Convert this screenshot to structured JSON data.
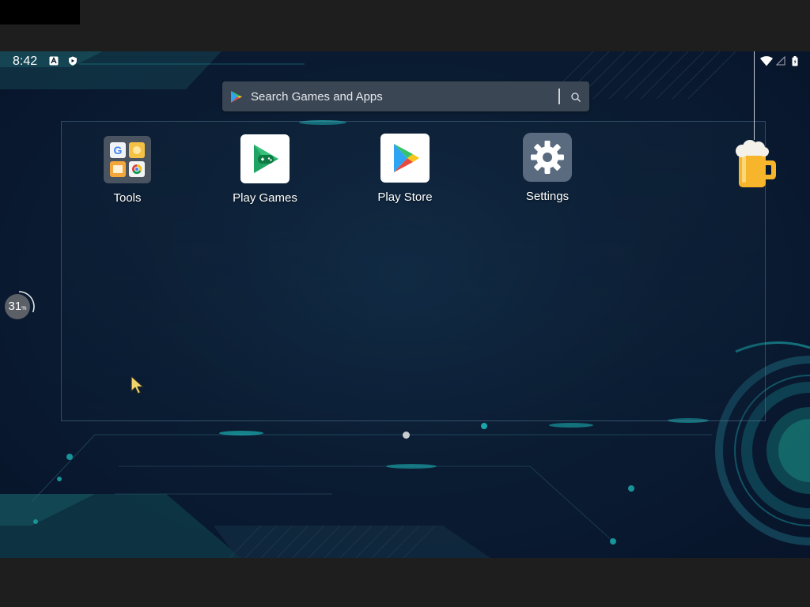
{
  "statusbar": {
    "time": "8:42",
    "left_icons": [
      "a-icon",
      "shield-icon"
    ],
    "right_icons": [
      "wifi-icon",
      "signal-icon",
      "battery-icon"
    ]
  },
  "search": {
    "placeholder": "Search Games and Apps",
    "icon": "play-store-icon"
  },
  "apps": [
    {
      "label": "Tools",
      "icon": "tools-folder-icon"
    },
    {
      "label": "Play Games",
      "icon": "play-games-icon"
    },
    {
      "label": "Play Store",
      "icon": "play-store-icon"
    },
    {
      "label": "Settings",
      "icon": "settings-gear-icon"
    }
  ],
  "progress": {
    "value": "31",
    "unit": "%",
    "fraction": 0.31
  },
  "pager": {
    "pages": 1,
    "current": 1
  },
  "colors": {
    "wallpaper": "#0b1d33",
    "accent_teal": "#1ec8c8",
    "search_bg": "#3b4654",
    "settings_tile": "#5a6b80"
  }
}
